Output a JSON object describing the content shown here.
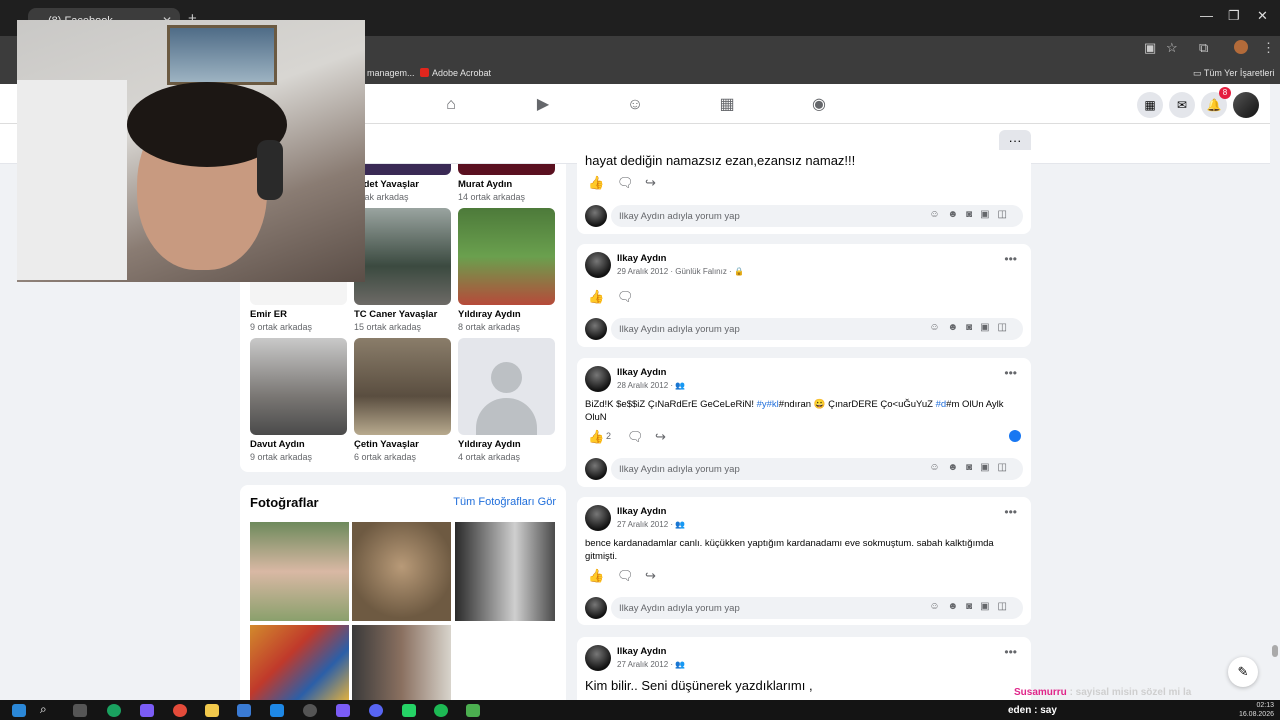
{
  "browser": {
    "tab_title": "(8) Facebook",
    "tab_close": "✕",
    "new_tab": "+",
    "window_controls": [
      "—",
      "❐",
      "✕"
    ],
    "bookmarks": [
      {
        "label": "managem..."
      },
      {
        "label": "Adobe Acrobat",
        "icon": "acrobat-icon"
      }
    ],
    "all_bookmarks": "Tüm Yer İşaretleri"
  },
  "fbnav": {
    "icons": [
      "home-icon",
      "video-icon",
      "friends-icon",
      "marketplace-icon",
      "groups-icon"
    ],
    "notifications_badge": "8",
    "more_label": "···"
  },
  "friends": [
    {
      "name": "Sadet Yavaşlar",
      "mutual": "ortak arkadaş",
      "partial": true
    },
    {
      "name": "Murat Aydın",
      "mutual": "14 ortak arkadaş"
    },
    {
      "name": "Emir ER",
      "mutual": "9 ortak arkadaş"
    },
    {
      "name": "TC Caner Yavaşlar",
      "mutual": "15 ortak arkadaş"
    },
    {
      "name": "Yıldıray Aydın",
      "mutual": "8 ortak arkadaş"
    },
    {
      "name": "Davut Aydın",
      "mutual": "9 ortak arkadaş"
    },
    {
      "name": "Çetin Yavaşlar",
      "mutual": "6 ortak arkadaş"
    },
    {
      "name": "Yıldıray Aydın",
      "mutual": "4 ortak arkadaş"
    }
  ],
  "photos": {
    "title": "Fotoğraflar",
    "see_all": "Tüm Fotoğrafları Gör"
  },
  "posts": [
    {
      "partial_text": "hayat dediğin namazsız ezan,ezansız namaz!!!",
      "comment_placeholder": "Ilkay Aydın adıyla yorum yap"
    },
    {
      "author": "Ilkay Aydın",
      "date": "29 Aralık 2012 · Günlük Falınız · ",
      "comment_placeholder": "Ilkay Aydın adıyla yorum yap"
    },
    {
      "author": "Ilkay Aydın",
      "date": "28 Aralık 2012 · ",
      "text_parts": [
        "BiZd!K $e$$iZ ÇıNaRdErE GeCeLeRiN! ",
        "#y",
        "#kl",
        "#ndıran 😀 ÇınarDERE Ço<uĞuYuZ ",
        "#d",
        "#m OlUn Aylk OluN"
      ],
      "like_count": "2",
      "comment_placeholder": "Ilkay Aydın adıyla yorum yap"
    },
    {
      "author": "Ilkay Aydın",
      "date": "27 Aralık 2012 · ",
      "text": "bence kardanadamlar canlı. küçükken yaptığım kardanadamı eve sokmuştum. sabah kalktığımda gitmişti.",
      "comment_placeholder": "Ilkay Aydın adıyla yorum yap"
    },
    {
      "author": "Ilkay Aydın",
      "date": "27 Aralık 2012 · ",
      "text": "Kim bilir.. Seni düşünerek yazdıklarımı ,"
    }
  ],
  "overlay": {
    "susam_pink": "Susamurru",
    "susam_rest": " : sayisal misin sözel mi la",
    "eden": "eden : say"
  },
  "clock": {
    "time": "02:13",
    "date": "16.08.2026"
  },
  "colors": {
    "accent": "#1877f2",
    "link": "#216fdb",
    "notification": "#e41e3f"
  }
}
